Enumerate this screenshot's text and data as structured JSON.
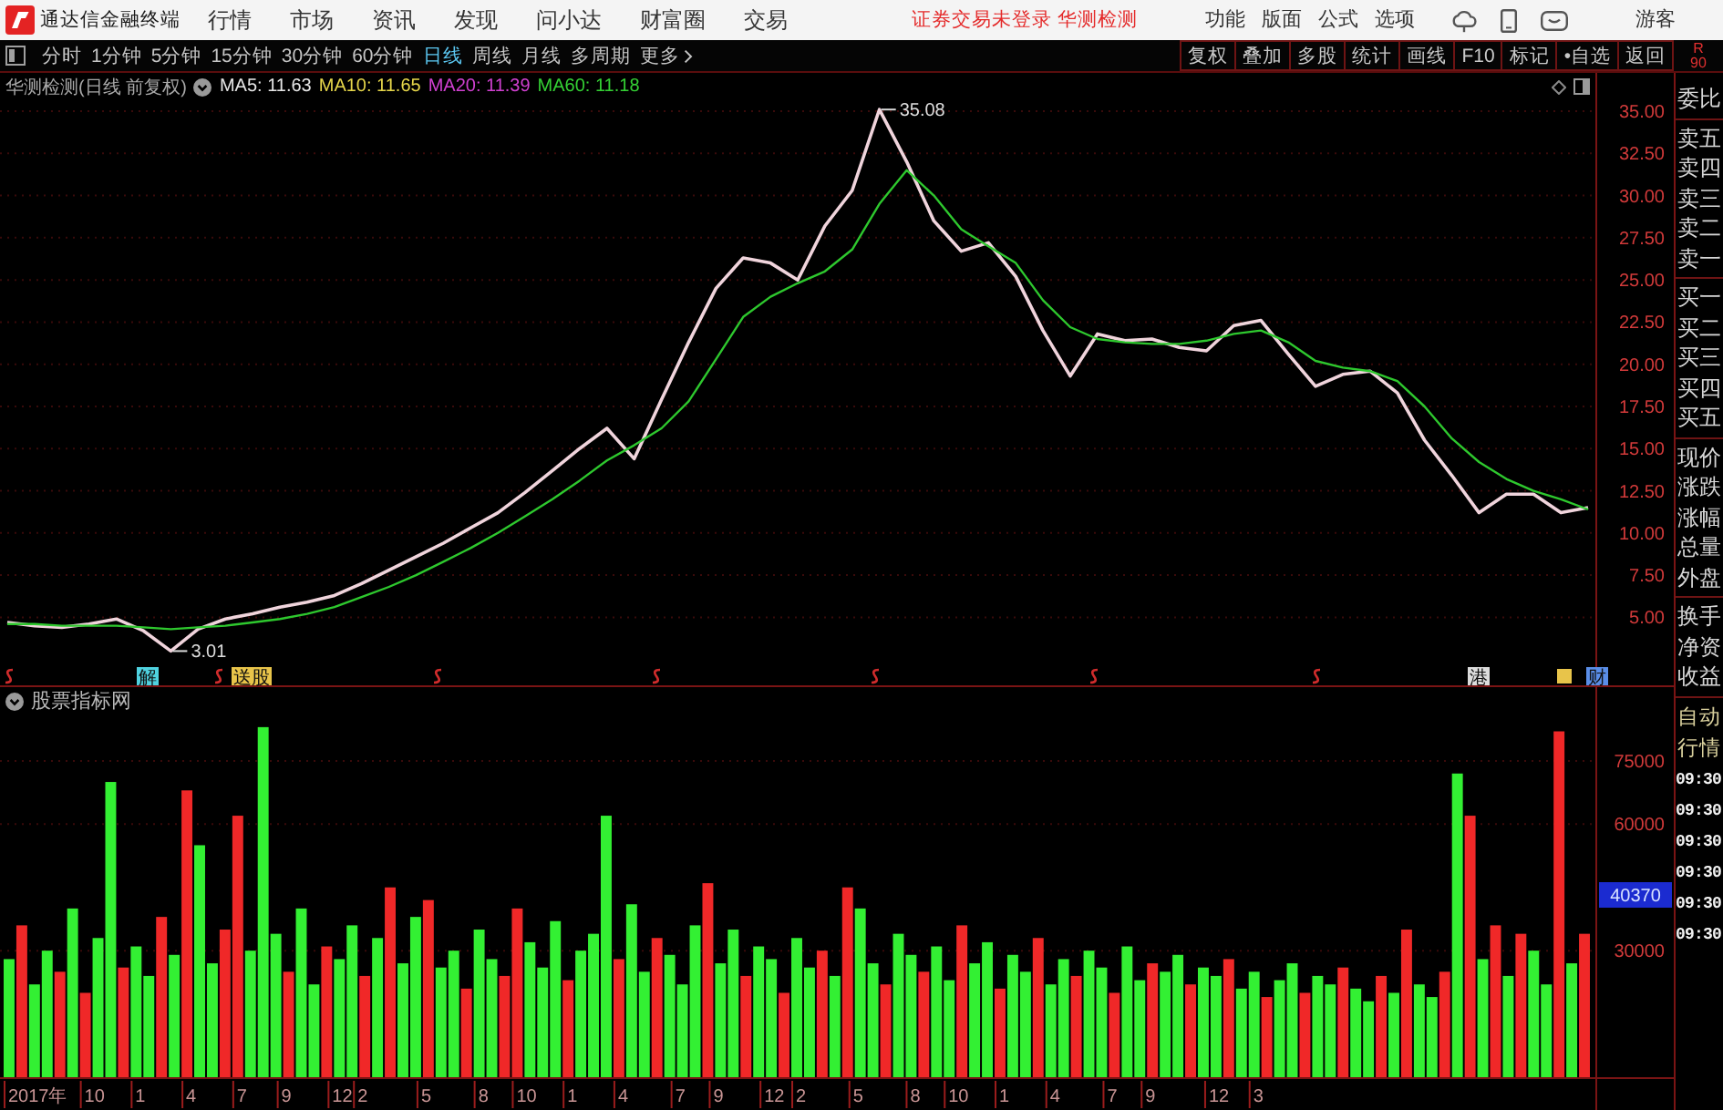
{
  "menubar": {
    "app_title": "通达信金融终端",
    "menus": [
      "行情",
      "市场",
      "资讯",
      "发现",
      "问小达",
      "财富圈",
      "交易"
    ],
    "notice": "证券交易未登录 华测检测",
    "actions": [
      "功能",
      "版面",
      "公式",
      "选项"
    ],
    "user": "游客"
  },
  "toolbar": {
    "periods": [
      {
        "label": "分时",
        "kind": "tab",
        "selected": false
      },
      {
        "label": "1分钟",
        "kind": "tab",
        "selected": false
      },
      {
        "label": "5分钟",
        "kind": "tab",
        "selected": false
      },
      {
        "label": "15分钟",
        "kind": "tab",
        "selected": false
      },
      {
        "label": "30分钟",
        "kind": "tab",
        "selected": false
      },
      {
        "label": "60分钟",
        "kind": "tab",
        "selected": false
      },
      {
        "label": "日线",
        "kind": "tab",
        "selected": true
      },
      {
        "label": "周线",
        "kind": "tab",
        "selected": false
      },
      {
        "label": "月线",
        "kind": "tab",
        "selected": false
      },
      {
        "label": "多周期",
        "kind": "tab",
        "selected": false
      },
      {
        "label": "更多",
        "kind": "menu",
        "selected": false
      }
    ],
    "tools": [
      "复权",
      "叠加",
      "多股",
      "统计",
      "画线",
      "F10",
      "标记",
      "•自选",
      "返回"
    ],
    "corner": [
      "R",
      "90"
    ]
  },
  "price_pane": {
    "title": "华测检测(日线 前复权)",
    "indicators": [
      {
        "label": "MA5: 11.63",
        "color": "#e6e6e6"
      },
      {
        "label": "MA10: 11.65",
        "color": "#e6d64a"
      },
      {
        "label": "MA20: 11.39",
        "color": "#d040d0"
      },
      {
        "label": "MA60: 11.18",
        "color": "#34d034"
      }
    ],
    "chart_data": {
      "type": "line",
      "series": [
        {
          "color": "#f0d4dc",
          "values": [
            4.7,
            4.5,
            4.4,
            4.6,
            4.9,
            4.2,
            3.0,
            4.3,
            4.9,
            5.2,
            5.6,
            5.9,
            6.3,
            7.0,
            7.8,
            8.6,
            9.4,
            10.3,
            11.2,
            12.4,
            13.7,
            15.0,
            16.2,
            14.4,
            17.9,
            21.3,
            24.5,
            26.3,
            26.0,
            25.0,
            28.2,
            30.3,
            35.1,
            32.0,
            28.5,
            26.7,
            27.2,
            25.2,
            22.0,
            19.3,
            21.8,
            21.4,
            21.5,
            21.0,
            20.8,
            22.3,
            22.6,
            20.6,
            18.7,
            19.4,
            19.6,
            18.3,
            15.5,
            13.4,
            11.2,
            12.3,
            12.3,
            11.2,
            11.5
          ]
        },
        {
          "color": "#2ec82e",
          "values": [
            4.6,
            4.6,
            4.5,
            4.5,
            4.5,
            4.4,
            4.3,
            4.4,
            4.5,
            4.7,
            4.9,
            5.2,
            5.6,
            6.2,
            6.8,
            7.5,
            8.3,
            9.1,
            10.0,
            11.0,
            12.0,
            13.1,
            14.3,
            15.2,
            16.2,
            17.8,
            20.3,
            22.8,
            24.0,
            24.8,
            25.5,
            26.8,
            29.5,
            31.5,
            30.0,
            28.0,
            27.0,
            26.0,
            23.8,
            22.2,
            21.5,
            21.3,
            21.2,
            21.2,
            21.4,
            21.8,
            22.0,
            21.3,
            20.2,
            19.8,
            19.6,
            19.0,
            17.5,
            15.6,
            14.2,
            13.2,
            12.5,
            12.0,
            11.4
          ]
        }
      ],
      "ylim": [
        2.05,
        35.65
      ],
      "grid": true,
      "yticks": [
        {
          "value": 35,
          "label": "35.00"
        },
        {
          "value": 32.5,
          "label": "32.50"
        },
        {
          "value": 30,
          "label": "30.00"
        },
        {
          "value": 27.5,
          "label": "27.50"
        },
        {
          "value": 25,
          "label": "25.00"
        },
        {
          "value": 22.5,
          "label": "22.50"
        },
        {
          "value": 20,
          "label": "20.00"
        },
        {
          "value": 17.5,
          "label": "17.50"
        },
        {
          "value": 15,
          "label": "15.00"
        },
        {
          "value": 12.5,
          "label": "12.50"
        },
        {
          "value": 10,
          "label": "10.00"
        },
        {
          "value": 7.5,
          "label": "7.50"
        },
        {
          "value": 5,
          "label": "5.00"
        }
      ],
      "annotations": [
        "3.01",
        "35.08"
      ]
    },
    "events": [
      {
        "kind": "mark"
      },
      {
        "kind": "tag",
        "label": "解",
        "color": "#4fd2e0"
      },
      {
        "kind": "mark"
      },
      {
        "kind": "tag",
        "label": "送股",
        "color": "#e8c44a"
      },
      {
        "kind": "mark"
      },
      {
        "kind": "mark"
      },
      {
        "kind": "mark"
      },
      {
        "kind": "mark"
      },
      {
        "kind": "mark"
      },
      {
        "kind": "tag",
        "label": "港",
        "color": "#dcdcdc"
      },
      {
        "kind": "square",
        "color": "#e8c44a"
      },
      {
        "kind": "tag",
        "label": "财",
        "color": "#5a8ee8"
      }
    ]
  },
  "volume_pane": {
    "title": "股票指标网",
    "chart_data": {
      "type": "bar",
      "series": [
        {
          "color": "#f02828",
          "values": [
            null,
            36000,
            null,
            null,
            25000,
            null,
            20000,
            null,
            null,
            26000,
            null,
            null,
            38000,
            null,
            68000,
            null,
            null,
            35000,
            62000,
            null,
            null,
            null,
            25000,
            null,
            null,
            31000,
            null,
            null,
            24000,
            null,
            45000,
            null,
            null,
            42000,
            null,
            null,
            21000,
            null,
            null,
            24000,
            40000,
            null,
            null,
            null,
            23000,
            null,
            null,
            null,
            28000,
            null,
            null,
            33000,
            null,
            null,
            null,
            46000,
            null,
            null,
            24000,
            null,
            null,
            20000,
            null,
            null,
            30000,
            null,
            45000,
            null,
            null,
            22000,
            null,
            null,
            25000,
            null,
            null,
            36000,
            null,
            null,
            21000,
            null,
            null,
            33000,
            null,
            null,
            24000,
            null,
            null,
            20000,
            null,
            null,
            27000,
            null,
            null,
            22000,
            null,
            null,
            28000,
            null,
            null,
            19000,
            null,
            null,
            20000,
            null,
            null,
            26000,
            null,
            null,
            24000,
            null,
            35000,
            null,
            null,
            25000,
            null,
            62000,
            null,
            36000,
            null,
            34000,
            null,
            null,
            82000,
            null,
            34000
          ]
        },
        {
          "color": "#33f033",
          "values": [
            28000,
            null,
            22000,
            30000,
            null,
            40000,
            null,
            33000,
            70000,
            null,
            31000,
            24000,
            null,
            29000,
            null,
            55000,
            27000,
            null,
            null,
            30000,
            83000,
            34000,
            null,
            40000,
            22000,
            null,
            28000,
            36000,
            null,
            33000,
            null,
            27000,
            38000,
            null,
            26000,
            30000,
            null,
            35000,
            28000,
            null,
            null,
            32000,
            26000,
            37000,
            null,
            30000,
            34000,
            62000,
            null,
            41000,
            25000,
            null,
            29000,
            22000,
            36000,
            null,
            27000,
            35000,
            null,
            31000,
            28000,
            null,
            33000,
            26000,
            null,
            24000,
            null,
            40000,
            27000,
            null,
            34000,
            29000,
            null,
            31000,
            23000,
            null,
            27000,
            32000,
            null,
            29000,
            25000,
            null,
            22000,
            28000,
            null,
            30000,
            26000,
            null,
            31000,
            23000,
            null,
            25000,
            29000,
            null,
            26000,
            24000,
            null,
            21000,
            25000,
            null,
            23000,
            27000,
            null,
            24000,
            22000,
            null,
            21000,
            18000,
            null,
            20000,
            null,
            22000,
            19000,
            null,
            72000,
            null,
            28000,
            null,
            24000,
            null,
            30000,
            22000,
            null,
            27000,
            null
          ]
        }
      ],
      "ylim": [
        0,
        86000
      ],
      "grid": true,
      "yticks": [
        30000,
        60000,
        75000
      ]
    },
    "cursor_value": "40370",
    "time_axis": [
      "2017年",
      "10",
      "1",
      "4",
      "7",
      "9",
      "12",
      "2",
      "5",
      "8",
      "10",
      "1",
      "4",
      "7",
      "9",
      "12",
      "2",
      "5",
      "8",
      "10",
      "1",
      "4",
      "7",
      "9",
      "12",
      "3"
    ]
  },
  "quote_panel": {
    "groups": [
      [
        "委比"
      ],
      [
        "卖五",
        "卖四",
        "卖三",
        "卖二",
        "卖一"
      ],
      [
        "买一",
        "买二",
        "买三",
        "买四",
        "买五"
      ],
      [
        "现价",
        "涨跌",
        "涨幅",
        "总量",
        "外盘"
      ],
      [
        "换手",
        "净资",
        "收益"
      ]
    ],
    "mode": [
      "自动",
      "行情"
    ],
    "times": [
      "09:30",
      "09:30",
      "09:30",
      "09:30",
      "09:30",
      "09:30"
    ]
  }
}
